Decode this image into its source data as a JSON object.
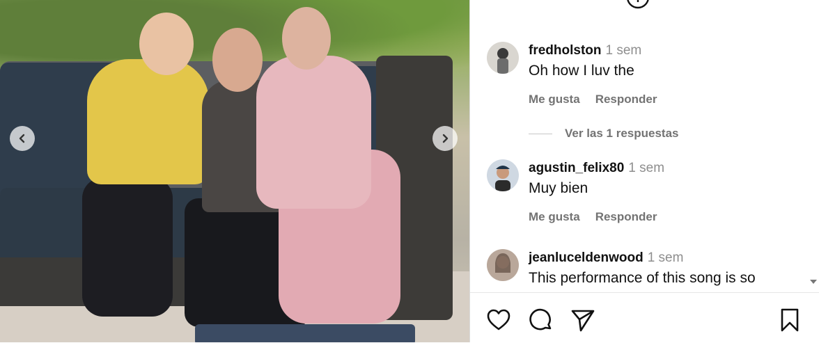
{
  "photo": {
    "prev_label": "‹",
    "next_label": "›"
  },
  "panel": {
    "add_icon": "plus-circle-icon",
    "comments": [
      {
        "username": "fredholston",
        "time": "1 sem",
        "text": "Oh how I luv the",
        "like_label": "Me gusta",
        "reply_label": "Responder",
        "view_replies": "Ver las 1 respuestas"
      },
      {
        "username": "agustin_felix80",
        "time": "1 sem",
        "text": "Muy bien",
        "like_label": "Me gusta",
        "reply_label": "Responder"
      },
      {
        "username": "jeanluceldenwood",
        "time": "1 sem",
        "text": "This performance of this song is so"
      }
    ]
  },
  "actions": {
    "like_icon": "heart-icon",
    "comment_icon": "comment-icon",
    "share_icon": "send-icon",
    "save_icon": "bookmark-icon"
  }
}
